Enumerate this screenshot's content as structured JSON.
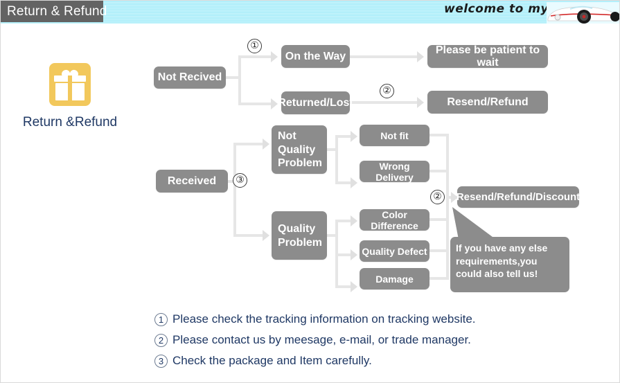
{
  "header": {
    "tab_label": "Return & Refund",
    "welcome_text": "welcome to my shop",
    "car_icon": "sports-car-image",
    "band_color": "#b2effa",
    "tab_color": "#636363"
  },
  "badge": {
    "icon": "gift-box-icon",
    "icon_color": "#f2c85c",
    "label": "Return &Refund",
    "label_color": "#1f3864"
  },
  "flow": {
    "node_color": "#8c8c8c",
    "connector_color": "#e6e6e6",
    "nodes": [
      {
        "id": "not-received",
        "label": "Not Recived"
      },
      {
        "id": "on-the-way",
        "label": "On the Way"
      },
      {
        "id": "returned-lost",
        "label": "Returned/Lost"
      },
      {
        "id": "be-patient",
        "label": "Please be patient to wait"
      },
      {
        "id": "resend-refund",
        "label": "Resend/Refund"
      },
      {
        "id": "received",
        "label": "Received"
      },
      {
        "id": "not-quality-problem",
        "label": "Not\nQuality\nProblem"
      },
      {
        "id": "quality-problem",
        "label": "Quality\nProblem"
      },
      {
        "id": "not-fit",
        "label": "Not fit"
      },
      {
        "id": "wrong-delivery",
        "label": "Wrong Delivery"
      },
      {
        "id": "color-difference",
        "label": "Color Difference"
      },
      {
        "id": "quality-defect",
        "label": "Quality Defect"
      },
      {
        "id": "damage",
        "label": "Damage"
      },
      {
        "id": "resend-refund-discount",
        "label": "Resend/Refund/Discount"
      }
    ],
    "markers": [
      {
        "id": "marker-1-top",
        "label": "①"
      },
      {
        "id": "marker-2-top",
        "label": "②"
      },
      {
        "id": "marker-3-mid",
        "label": "③"
      },
      {
        "id": "marker-2-right",
        "label": "②"
      }
    ],
    "callout": "If you have any else requirements,you could also tell us!"
  },
  "legend": {
    "items": [
      {
        "num": "1",
        "text": "Please check the tracking information on tracking website."
      },
      {
        "num": "2",
        "text": "Please contact us by meesage, e-mail, or trade manager."
      },
      {
        "num": "3",
        "text": "Check the package and Item carefully."
      }
    ]
  }
}
